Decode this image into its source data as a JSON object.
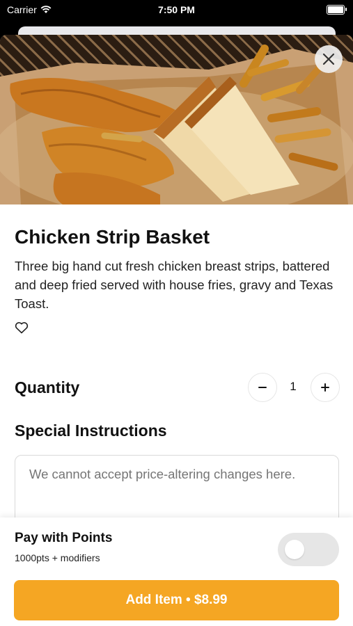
{
  "status_bar": {
    "carrier": "Carrier",
    "time": "7:50 PM"
  },
  "item": {
    "title": "Chicken Strip Basket",
    "description": "Three big hand cut fresh chicken breast strips, battered and deep fried served with house fries, gravy and Texas Toast."
  },
  "quantity": {
    "label": "Quantity",
    "value": "1",
    "minus": "−",
    "plus": "+"
  },
  "special_instructions": {
    "label": "Special Instructions",
    "placeholder": "We cannot accept price-altering changes here."
  },
  "points": {
    "label": "Pay with Points",
    "sub": "1000pts + modifiers",
    "enabled": false
  },
  "add_button": {
    "label": "Add Item • $8.99"
  },
  "colors": {
    "accent": "#f5a623",
    "toggle_off": "#e6e6e6"
  },
  "icons": {
    "close": "close-icon",
    "favorite": "heart-icon",
    "wifi": "wifi-icon",
    "battery": "battery-icon"
  }
}
